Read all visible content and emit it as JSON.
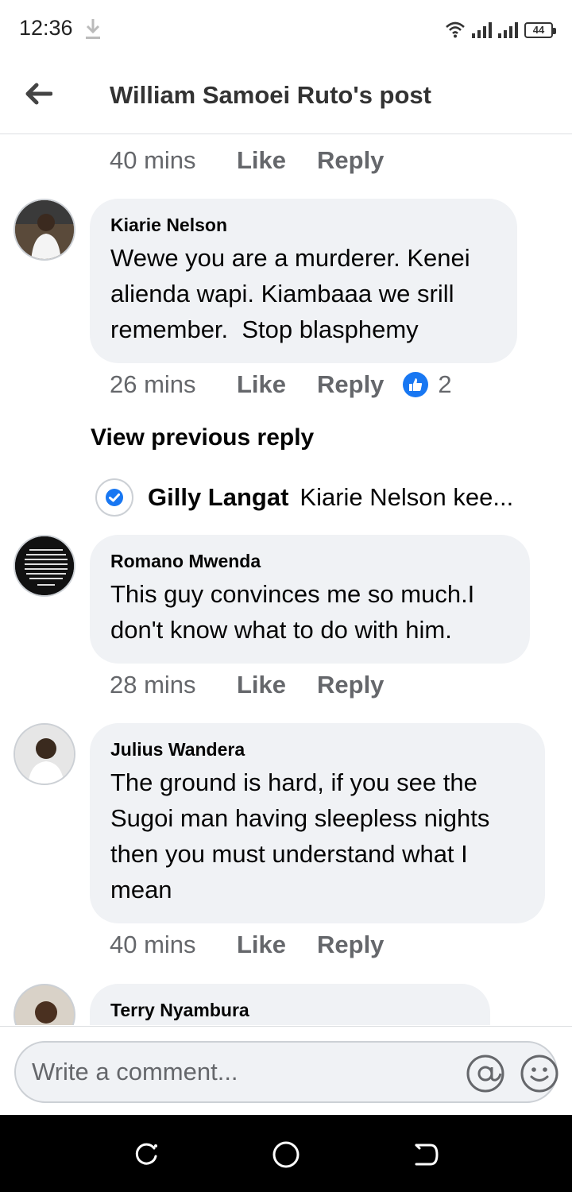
{
  "status_bar": {
    "time": "12:36",
    "battery": "44",
    "icons": [
      "download-icon",
      "wifi-icon",
      "signal-icon",
      "signal-icon",
      "battery-icon"
    ]
  },
  "header": {
    "back_icon": "arrow-left-icon",
    "title": "William Samoei Ruto's post"
  },
  "comments": [
    {
      "time": "40 mins",
      "like": "Like",
      "reply": "Reply"
    },
    {
      "author": "Kiarie Nelson",
      "text": "Wewe you are a murderer. Kenei alienda wapi. Kiambaaa we srill remember.  Stop blasphemy",
      "time": "26 mins",
      "like": "Like",
      "reply": "Reply",
      "reaction_count": "2",
      "reaction_icon": "thumbs-up-icon"
    },
    {
      "author": "Romano Mwenda",
      "text": "This guy convinces me so much.I don't know what to do with him.",
      "time": "28 mins",
      "like": "Like",
      "reply": "Reply"
    },
    {
      "author": "Julius Wandera",
      "text": "The ground is hard, if you see the Sugoi man having sleepless nights then you must understand what I mean",
      "time": "40 mins",
      "like": "Like",
      "reply": "Reply"
    },
    {
      "author": "Terry Nyambura"
    }
  ],
  "view_previous_reply": "View previous reply",
  "reply_preview": {
    "author": "Gilly Langat",
    "snippet": "Kiarie Nelson kee..."
  },
  "composer": {
    "placeholder": "Write a comment...",
    "mention_icon": "at-sign-icon",
    "emoji_icon": "emoji-icon"
  },
  "colors": {
    "bubble": "#f0f2f5",
    "meta_text": "#65676b",
    "accent": "#1877f2"
  }
}
